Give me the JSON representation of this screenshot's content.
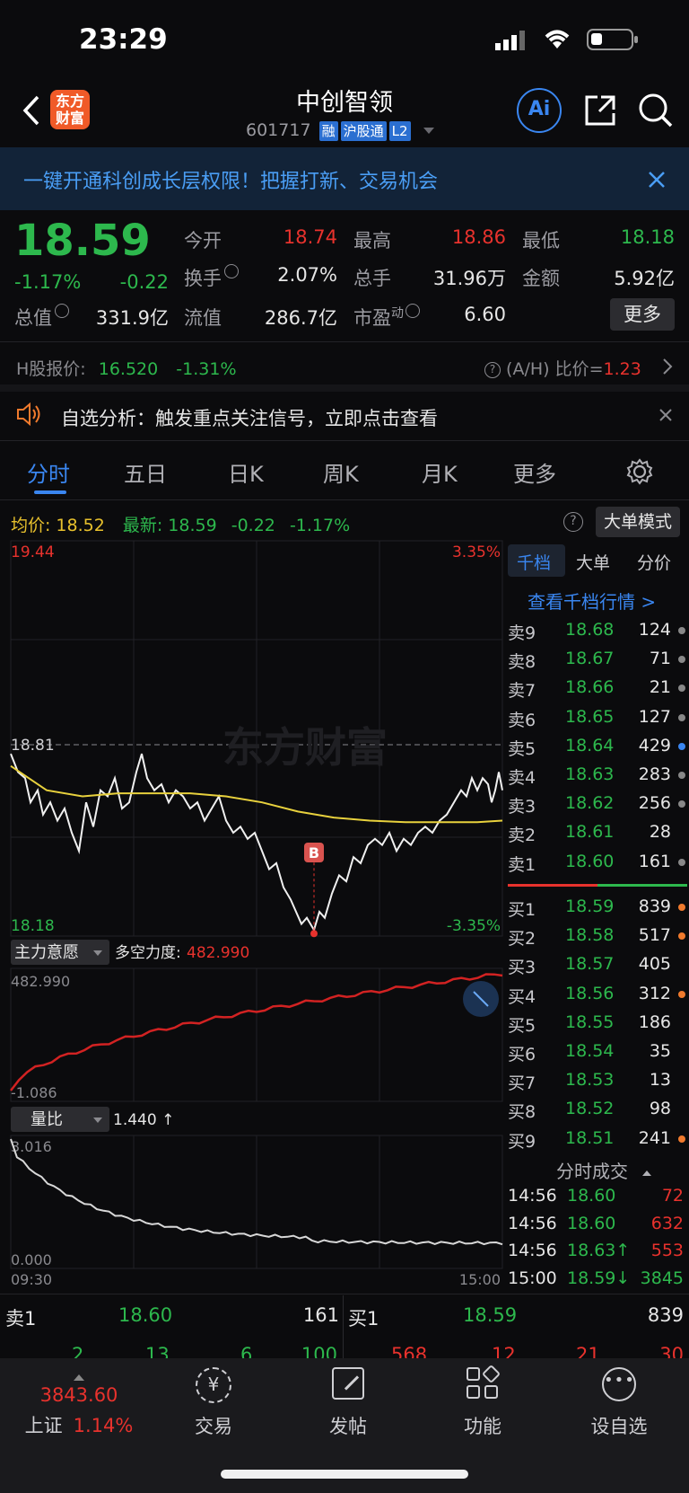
{
  "status_bar": {
    "time": "23:29"
  },
  "header": {
    "title": "中创智领",
    "code": "601717",
    "tags": [
      "融",
      "沪股通",
      "L2"
    ],
    "logo_text": "东方财富",
    "ai_label": "Ai"
  },
  "banner": {
    "text": "一键开通科创成长层权限！把握打新、交易机会"
  },
  "quote": {
    "price": "18.59",
    "change_pct": "-1.17%",
    "change": "-0.22",
    "open_label": "今开",
    "open": "18.74",
    "high_label": "最高",
    "high": "18.86",
    "low_label": "最低",
    "low": "18.18",
    "turnover_label": "换手",
    "turnover": "2.07%",
    "volume_label": "总手",
    "volume": "31.96万",
    "amount_label": "金额",
    "amount": "5.92亿",
    "mktcap_label": "总值",
    "mktcap": "331.9亿",
    "float_label": "流值",
    "float": "286.7亿",
    "pe_label": "市盈",
    "pe_sup": "动",
    "pe": "6.60",
    "more_label": "更多"
  },
  "h_share": {
    "label": "H股报价:",
    "price": "16.520",
    "pct": "-1.31%",
    "ratio_label": "(A/H) 比价=",
    "ratio": "1.23"
  },
  "notice": {
    "text": "自选分析：触发重点关注信号，立即点击查看"
  },
  "tabs": [
    "分时",
    "五日",
    "日K",
    "周K",
    "月K",
    "更多"
  ],
  "chart_header": {
    "avg_label": "均价:",
    "avg": "18.52",
    "last_label": "最新:",
    "last": "18.59",
    "chg": "-0.22",
    "pct": "-1.17%",
    "big_order_mode": "大单模式"
  },
  "chart_data": {
    "type": "line",
    "ylim": [
      18.18,
      19.44
    ],
    "y_top_label": "19.44",
    "y_mid_label": "18.81",
    "y_bottom_label": "18.18",
    "pct_top_label": "3.35%",
    "pct_bottom_label": "-3.35%",
    "x_start_label": "09:30",
    "x_end_label": "15:00",
    "prev_close": 18.81,
    "watermark": "东方财富",
    "marker_label": "B",
    "indicator1": {
      "name": "主力意愿",
      "sub_label": "多空力度:",
      "sub_value": "482.990",
      "max_label": "482.990",
      "min_label": "-1.086"
    },
    "indicator2": {
      "name": "量比",
      "value": "1.440 ↑",
      "max_label": "3.016",
      "min_label": "0.000"
    }
  },
  "order_book": {
    "tabs": [
      "千档",
      "大单",
      "分价"
    ],
    "link": "查看千档行情 >",
    "asks": [
      {
        "label": "卖9",
        "price": "18.68",
        "vol": "124",
        "dot": "#888888"
      },
      {
        "label": "卖8",
        "price": "18.67",
        "vol": "71",
        "dot": "#888888"
      },
      {
        "label": "卖7",
        "price": "18.66",
        "vol": "21",
        "dot": "#888888"
      },
      {
        "label": "卖6",
        "price": "18.65",
        "vol": "127",
        "dot": "#888888"
      },
      {
        "label": "卖5",
        "price": "18.64",
        "vol": "429",
        "dot": "#3a86f0"
      },
      {
        "label": "卖4",
        "price": "18.63",
        "vol": "283",
        "dot": "#888888"
      },
      {
        "label": "卖3",
        "price": "18.62",
        "vol": "256",
        "dot": "#888888"
      },
      {
        "label": "卖2",
        "price": "18.61",
        "vol": "28",
        "dot": ""
      },
      {
        "label": "卖1",
        "price": "18.60",
        "vol": "161",
        "dot": "#888888"
      }
    ],
    "bids": [
      {
        "label": "买1",
        "price": "18.59",
        "vol": "839",
        "dot": "#f07a2d"
      },
      {
        "label": "买2",
        "price": "18.58",
        "vol": "517",
        "dot": "#f07a2d"
      },
      {
        "label": "买3",
        "price": "18.57",
        "vol": "405",
        "dot": ""
      },
      {
        "label": "买4",
        "price": "18.56",
        "vol": "312",
        "dot": "#f07a2d"
      },
      {
        "label": "买5",
        "price": "18.55",
        "vol": "186",
        "dot": ""
      },
      {
        "label": "买6",
        "price": "18.54",
        "vol": "35",
        "dot": ""
      },
      {
        "label": "买7",
        "price": "18.53",
        "vol": "13",
        "dot": ""
      },
      {
        "label": "买8",
        "price": "18.52",
        "vol": "98",
        "dot": ""
      },
      {
        "label": "买9",
        "price": "18.51",
        "vol": "241",
        "dot": "#f07a2d"
      }
    ],
    "trades_title": "分时成交",
    "trades": [
      {
        "time": "14:56",
        "price": "18.60",
        "vol": "72",
        "color": "#e8322d"
      },
      {
        "time": "14:56",
        "price": "18.60",
        "vol": "632",
        "color": "#e8322d"
      },
      {
        "time": "14:56",
        "price": "18.63↑",
        "vol": "553",
        "color": "#e8322d"
      },
      {
        "time": "15:00",
        "price": "18.59↓",
        "vol": "3845",
        "color": "#2db84d"
      }
    ]
  },
  "bottom_bar": {
    "sell1_label": "卖1",
    "sell1_price": "18.60",
    "sell1_vol": "161",
    "buy1_label": "买1",
    "buy1_price": "18.59",
    "buy1_vol": "839",
    "partial_left": [
      "2",
      "13",
      "6",
      "100"
    ],
    "partial_right": [
      "568",
      "12",
      "21",
      "30"
    ]
  },
  "nav": {
    "index_value": "3843.60",
    "index_name": "上证",
    "index_pct": "1.14%",
    "items": [
      "交易",
      "发帖",
      "功能",
      "设自选"
    ]
  }
}
